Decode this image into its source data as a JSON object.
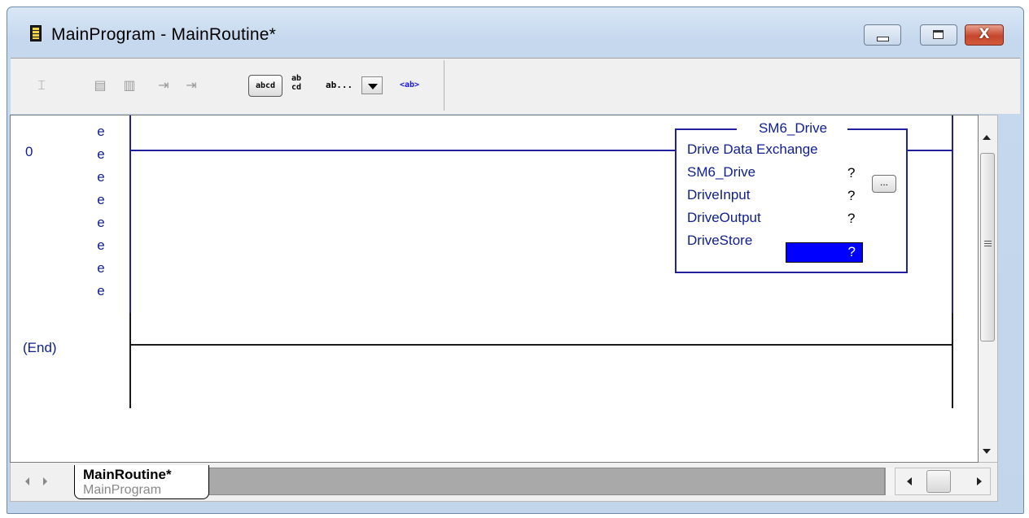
{
  "window": {
    "title": "MainProgram - MainRoutine*",
    "close_glyph": "X"
  },
  "toolbar": {
    "buttons": [
      "branch-icon",
      "rung-up-icon",
      "rung-down-icon",
      "goto-icon",
      "goto-end-icon"
    ],
    "abcd_label": "abcd",
    "abcd_stacked_top": "ab",
    "abcd_stacked_bottom": "cd",
    "combo_value": "ab...",
    "ab_tag_label": "<ab>"
  },
  "ladder": {
    "rung_number": "0",
    "edit_markers": [
      "e",
      "e",
      "e",
      "e",
      "e",
      "e",
      "e",
      "e"
    ],
    "end_label": "(End)",
    "instruction": {
      "title": "SM6_Drive",
      "name": "Drive Data Exchange",
      "operands": [
        {
          "label": "SM6_Drive",
          "value": "?",
          "has_browse": true
        },
        {
          "label": "DriveInput",
          "value": "?"
        },
        {
          "label": "DriveOutput",
          "value": "?"
        },
        {
          "label": "DriveStore",
          "value": "?",
          "selected": true
        }
      ],
      "browse_label": "...",
      "selection_color": "#0000ff",
      "wire_color": "#2020a0"
    }
  },
  "tabs": {
    "active": {
      "title": "MainRoutine*",
      "subtitle": "MainProgram"
    }
  },
  "colors": {
    "accent": "#102090",
    "window_frame": "#c6d8ee"
  }
}
